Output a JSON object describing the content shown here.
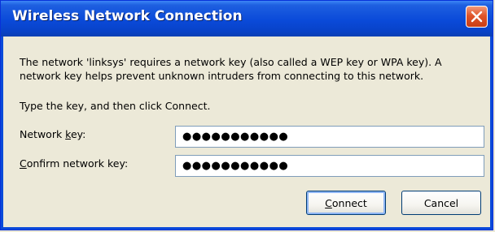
{
  "window": {
    "title": "Wireless Network Connection"
  },
  "dialog": {
    "message": "The network 'linksys' requires a network key (also called a WEP key or WPA key). A network key helps prevent unknown intruders from connecting to this network.",
    "instruction": "Type the key, and then click Connect.",
    "network_key_label_pre": "Network ",
    "network_key_label_u": "k",
    "network_key_label_post": "ey:",
    "network_key_value": "●●●●●●●●●●●",
    "confirm_key_label_pre": "",
    "confirm_key_label_u": "C",
    "confirm_key_label_post": "onfirm network key:",
    "confirm_key_value": "●●●●●●●●●●●",
    "connect_label_u": "C",
    "connect_label_post": "onnect",
    "cancel_label": "Cancel"
  },
  "colors": {
    "titlebar": "#0a4ad9",
    "close": "#e0552a",
    "background": "#ece9d8"
  }
}
